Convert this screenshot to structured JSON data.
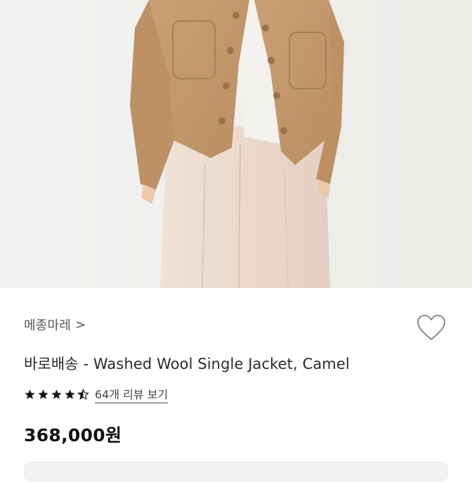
{
  "product": {
    "brand": "메종마레",
    "brand_chevron": ">",
    "title": "바로배송 - Washed Wool Single Jacket, Camel",
    "rating": 4.5,
    "review_link": "64개 리뷰 보기",
    "price": "368,000원"
  },
  "colors": {
    "star": "#1a1a1a",
    "photo_background": "#f1f1ef",
    "jacket": "#c59a6d",
    "trousers": "#ecdcd0"
  },
  "icons": {
    "wishlist": "heart-outline-icon",
    "rating": "star-icon"
  }
}
